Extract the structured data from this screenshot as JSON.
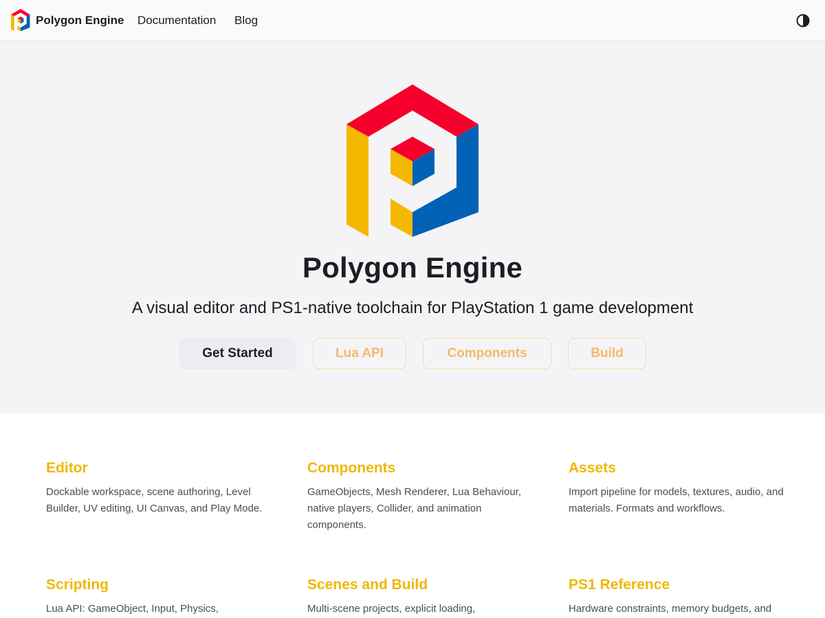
{
  "nav": {
    "brand_title": "Polygon Engine",
    "links": [
      "Documentation",
      "Blog"
    ],
    "theme_toggle_icon": "contrast-icon"
  },
  "hero": {
    "title": "Polygon Engine",
    "tagline": "A visual editor and PS1-native toolchain for PlayStation 1 game development",
    "buttons": [
      "Get Started",
      "Lua API",
      "Components",
      "Build"
    ]
  },
  "features": [
    {
      "title": "Editor",
      "desc": "Dockable workspace, scene authoring, Level Builder, UV editing, UI Canvas, and Play Mode."
    },
    {
      "title": "Components",
      "desc": "GameObjects, Mesh Renderer, Lua Behaviour, native players, Collider, and animation components."
    },
    {
      "title": "Assets",
      "desc": "Import pipeline for models, textures, audio, and materials. Formats and workflows."
    },
    {
      "title": "Scripting",
      "desc": "Lua API: GameObject, Input, Physics,"
    },
    {
      "title": "Scenes and Build",
      "desc": "Multi-scene projects, explicit loading,"
    },
    {
      "title": "PS1 Reference",
      "desc": "Hardware constraints, memory budgets, and"
    }
  ],
  "colors": {
    "logo_red": "#f5002c",
    "logo_yellow": "#f5b800",
    "logo_blue": "#0061b5",
    "accent": "#f1b700",
    "outline_button": "#f6b868"
  }
}
